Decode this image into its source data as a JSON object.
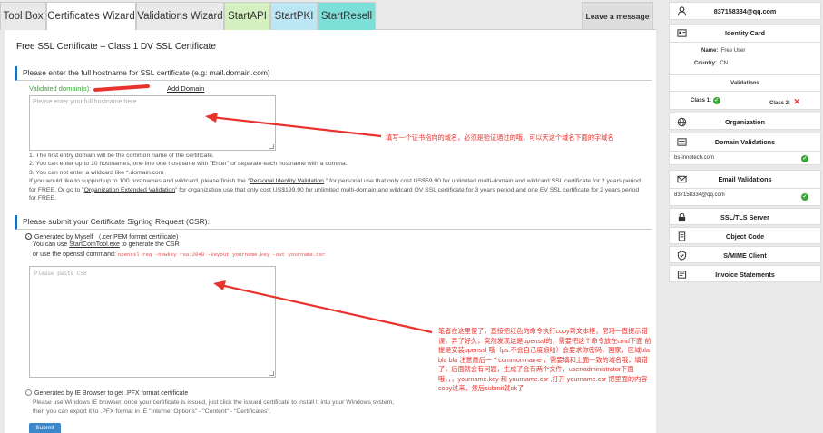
{
  "tabs": [
    "Tool Box",
    "Certificates Wizard",
    "Validations Wizard",
    "StartAPI",
    "StartPKI",
    "StartResell"
  ],
  "tab_colors": {
    "StartAPI": "#d4f0c0",
    "StartPKI": "#bde6f5",
    "StartResell": "#7de0d8"
  },
  "leave_message": "Leave a message",
  "page_title": "Free SSL Certificate – Class 1 DV SSL Certificate",
  "section1_heading": "Please enter the full hostname for SSL certificate (e.g: mail.domain.com)",
  "validated_label": "Validated domain(s):",
  "add_domain": "Add Domain",
  "hostname_placeholder": "Please enter your full hostname here",
  "notes": {
    "n1": "1. The first entry domain will be the common name of the certificate.",
    "n2": "2. You can enter up to 10 hostnames, one line one hostname with \"Enter\" or separate each hostname with a comma.",
    "n3": "3. You can not enter a wildcard like *.domain.com",
    "p1a": "If you would like to support up to 100 hostnames and wildcard, please finish the \"",
    "p1link": "Personal Identity Validation",
    "p1b": " \" for personal use that only cost US$59.90 for unlimited multi-domain and wildcard SSL certificate for 2 years period for FREE. Or go to \"",
    "p1link2": "Organization Extended Validation",
    "p1c": "\" for organization use that only cost US$199.90 for unlimited multi-domain and wildcard OV SSL certificate for 3 years period and one EV SSL certificate for 2 years period for FREE."
  },
  "section2_heading": "Please submit your Certificate Signing Request (CSR):",
  "csr": {
    "option1": "Generated by Myself （.cer PEM format certificate)",
    "line1a": "You can use ",
    "line1link": "StartComTool.exe",
    "line1b": " to generate the CSR",
    "line2": "or use the openssl command:",
    "command": "openssl req -newkey rsa:2048 -keyout yourname.key -out yourname.csr",
    "placeholder": "Please paste CSR",
    "option2": "Generated by IE Browser to get .PFX format certificate",
    "ie1": "Please use Windows IE browser, once your certificate is issued, just click the issued certificate to install it into your Windows system,",
    "ie2": "then you can export it to .PFX format in IE \"Internet Options\" - \"Content\" - \"Certificates\"."
  },
  "submit": "Submit",
  "annotation1": "填写一个证书指向的域名，必须是验证通过的哦，可以天这个域名下面的字域名",
  "annotation2": "笔者在这里傻了，直接把红色的命令执行copy到文本框，尼玛一直提示错误，弄了好久，突然发现这是openssl的，需要把这个命令放在cmd下面 前提是安装openssl 哦（ps:不会自己度娘哈）会要求你密码，国家，区域bla bla bla 注意最后一个common name ，需要填和上面一致的域名哦，填错了，后面就会有问题，生成了会有两个文件，user/administrator下面哦，，，yourname.key 和 yourname.csr ,打开 yourname.csr 把里面的内容copy过来，然后submit就ok了",
  "sidebar": {
    "email": "837158334@qq.com",
    "identity_title": "Identity Card",
    "name_label": "Name:",
    "name_value": "Free User",
    "country_label": "Country:",
    "country_value": "CN",
    "validations_title": "Validations",
    "class1": "Class 1:",
    "class2": "Class 2:",
    "organization": "Organization",
    "domain_validations": "Domain Validations",
    "domain": "bs-innotech.com",
    "email_validations": "Email Validations",
    "email_value": "837158334@qq.com",
    "ssl_tls": "SSL/TLS Server",
    "object_code": "Object Code",
    "smime": "S/MIME Client",
    "invoice": "Invoice Statements"
  }
}
